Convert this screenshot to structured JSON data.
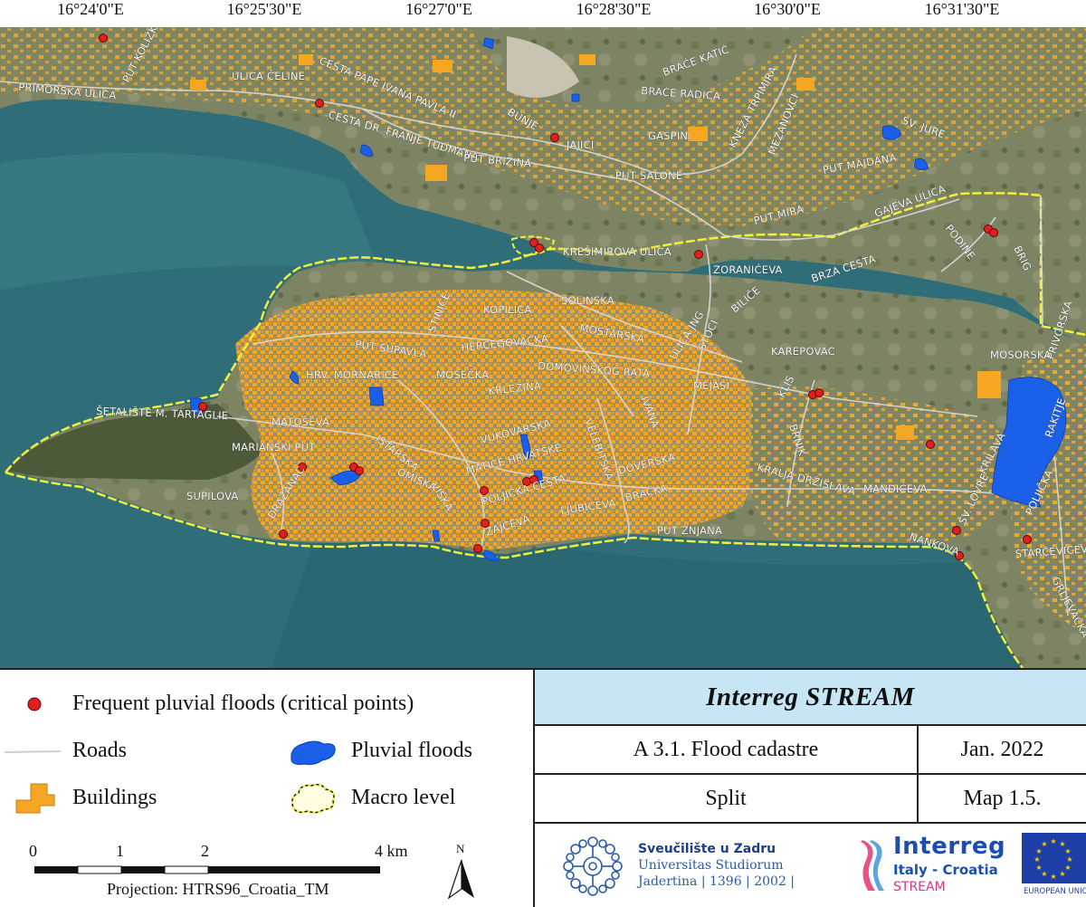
{
  "map": {
    "coordinates": [
      "16°24'0\"E",
      "16°25'30\"E",
      "16°27'0\"E",
      "16°28'30\"E",
      "16°30'0\"E",
      "16°31'30\"E"
    ],
    "streets": [
      "PUT KOLIŽKA",
      "ULICA ČELINE",
      "PRIMORSKA ULICA",
      "CESTA PAPE IVANA PAVLA II",
      "CESTA DR. FRANJE TUĐMANA",
      "PUT BRIŽINA",
      "BUNJE",
      "JAJIĆI",
      "BRAĆE KATIĆ",
      "BRAĆE RADIĆA",
      "GASPINI",
      "KNEZA TRPIMIRA",
      "MEZANOVCI",
      "PUT SALONE",
      "SV. JURE",
      "PUT MAJDANA",
      "GAJEVA ULICA",
      "PUT MIRA",
      "KREŠIMIROVA ULICA",
      "ZORANIĆEVA",
      "PODINE",
      "BRIG",
      "BRZA CESTA",
      "BILIČE",
      "SOLINSKA",
      "KOPILICA",
      "MOSTARSKA",
      "STINICE",
      "PUT SUPAVLA",
      "HERCEGOVAČKA",
      "DOMOVINSKOG RATA",
      "ULICA JNG",
      "STOCI",
      "KAREPOVAC",
      "PRIVORSKA",
      "HRV. MORNARICE",
      "MOSEČKA",
      "KRLEŽINA",
      "MEJAŠI",
      "MOSORSKA",
      "ŠETALIŠTE M. TARTAGLIE",
      "MATOŠEVA",
      "IVANA",
      "KLIS",
      "ISTARSKA",
      "VUKOVARSKA",
      "VELEBITSKA",
      "BRNIK",
      "RAKITJE",
      "MARIANSKI PUT",
      "OMIŠKA",
      "MATICE HRVATSKE",
      "DOVERSKA",
      "KRALJA DRŽISLAVA",
      "MANDIĆEVA",
      "KRILAVA",
      "SUPILOVA",
      "DRAŽANAC",
      "VIŠKA",
      "POLJIČKA CESTA",
      "BRAČKA",
      "LJUBIČEVA",
      "SV. LOVRE",
      "POLJIČKA",
      "ZAJČEVA",
      "PUT ŽNJANA",
      "NANKOVA",
      "STARČEVIĆEVA",
      "GRLJEVAČKA"
    ],
    "critical_point_count": 24
  },
  "legend": {
    "items": [
      {
        "label": "Frequent pluvial floods (critical points)",
        "symbol": "red-dot"
      },
      {
        "label": "Roads",
        "symbol": "grey-line"
      },
      {
        "label": "Pluvial floods",
        "symbol": "blue-blob"
      },
      {
        "label": "Buildings",
        "symbol": "orange-blocks"
      },
      {
        "label": "Macro level",
        "symbol": "yellow-dashed-outline"
      }
    ],
    "scale": {
      "ticks": [
        "0",
        "1",
        "2",
        "4 km"
      ]
    },
    "north": "N",
    "projection": "Projection: HTRS96_Croatia_TM"
  },
  "title_block": {
    "program": "Interreg  STREAM",
    "activity": "A 3.1. Flood cadastre",
    "date": "Jan. 2022",
    "city": "Split",
    "map_number": "Map 1.5."
  },
  "logos": {
    "university": {
      "line1": "Sveučilište u Zadru",
      "line2": "Universitas Studiorum",
      "line3": "Jadertina | 1396 | 2002 |"
    },
    "interreg": {
      "line1": "Interreg",
      "line2": "Italy - Croatia",
      "line3": "STREAM"
    },
    "eu": {
      "label": "EUROPEAN UNION"
    }
  },
  "colors": {
    "sea": "#2f6e78",
    "land": "#8a8f6a",
    "buildings": "#f5a623",
    "critical_point": "#e02020",
    "pluvial_flood": "#1a5fe8",
    "macro_level": "#f2ef3a",
    "roads": "#d8d8d8",
    "title_band": "#c6e6f5"
  }
}
